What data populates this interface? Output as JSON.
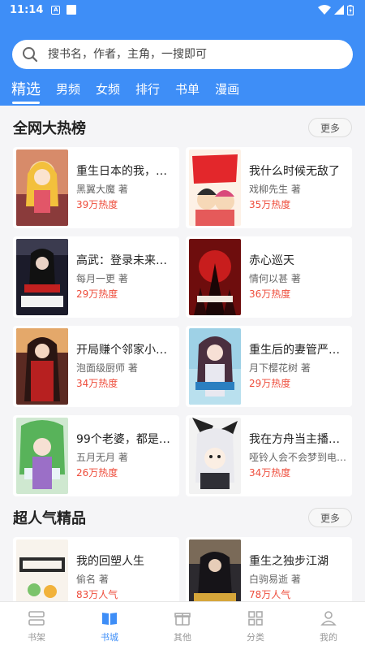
{
  "status_bar": {
    "time": "11:14"
  },
  "search": {
    "placeholder": "搜书名，作者，主角，一搜即可"
  },
  "tabs": [
    {
      "label": "精选",
      "active": true
    },
    {
      "label": "男频"
    },
    {
      "label": "女频"
    },
    {
      "label": "排行"
    },
    {
      "label": "书单"
    },
    {
      "label": "漫画"
    }
  ],
  "sections": [
    {
      "title": "全网大热榜",
      "more_label": "更多",
      "books": [
        {
          "title": "重生日本的我，在…",
          "author": "黑翼大魔 著",
          "heat": "39万热度"
        },
        {
          "title": "我什么时候无敌了",
          "author": "戏柳先生 著",
          "heat": "35万热度"
        },
        {
          "title": "高武：登录未来一…",
          "author": "每月一更 著",
          "heat": "29万热度"
        },
        {
          "title": "赤心巡天",
          "author": "情何以甚 著",
          "heat": "36万热度"
        },
        {
          "title": "开局赚个邻家小姐…",
          "author": "泡面级厨师 著",
          "heat": "34万热度"
        },
        {
          "title": "重生后的妻管严生…",
          "author": "月下樱花树 著",
          "heat": "29万热度"
        },
        {
          "title": "99个老婆，都是我…",
          "author": "五月无月 著",
          "heat": "26万热度"
        },
        {
          "title": "我在方舟当主播，…",
          "author": "哑铃人会不会梦到电…",
          "heat": "34万热度"
        }
      ]
    },
    {
      "title": "超人气精品",
      "more_label": "更多",
      "books": [
        {
          "title": "我的回塑人生",
          "author": "偷名 著",
          "heat": "83万人气"
        },
        {
          "title": "重生之独步江湖",
          "author": "白驹易逝 著",
          "heat": "78万人气"
        }
      ]
    }
  ],
  "bottom_nav": [
    {
      "label": "书架",
      "icon": "bookshelf-icon"
    },
    {
      "label": "书城",
      "icon": "book-city-icon",
      "active": true
    },
    {
      "label": "其他",
      "icon": "gift-icon"
    },
    {
      "label": "分类",
      "icon": "grid-icon"
    },
    {
      "label": "我的",
      "icon": "person-icon"
    }
  ],
  "colors": {
    "brand": "#3e8ef7",
    "heat": "#ee4d3c"
  }
}
